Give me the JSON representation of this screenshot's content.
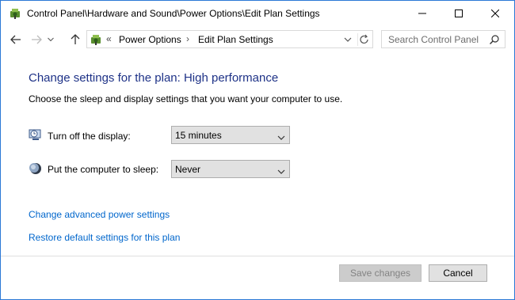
{
  "window": {
    "title": "Control Panel\\Hardware and Sound\\Power Options\\Edit Plan Settings"
  },
  "nav": {
    "crumb_chevron": "«",
    "breadcrumbs": [
      "Power Options",
      "Edit Plan Settings"
    ],
    "crumb_separator": "›"
  },
  "search": {
    "placeholder": "Search Control Panel"
  },
  "main": {
    "heading": "Change settings for the plan: High performance",
    "subtext": "Choose the sleep and display settings that you want your computer to use.",
    "settings": [
      {
        "label": "Turn off the display:",
        "value": "15 minutes",
        "icon": "display-timer-icon"
      },
      {
        "label": "Put the computer to sleep:",
        "value": "Never",
        "icon": "moon-sleep-icon"
      }
    ],
    "links": [
      "Change advanced power settings",
      "Restore default settings for this plan"
    ]
  },
  "footer": {
    "save_label": "Save changes",
    "cancel_label": "Cancel",
    "save_enabled": false
  },
  "colors": {
    "heading": "#1e3287",
    "link": "#0066cc",
    "window_border": "#2b78d6"
  }
}
